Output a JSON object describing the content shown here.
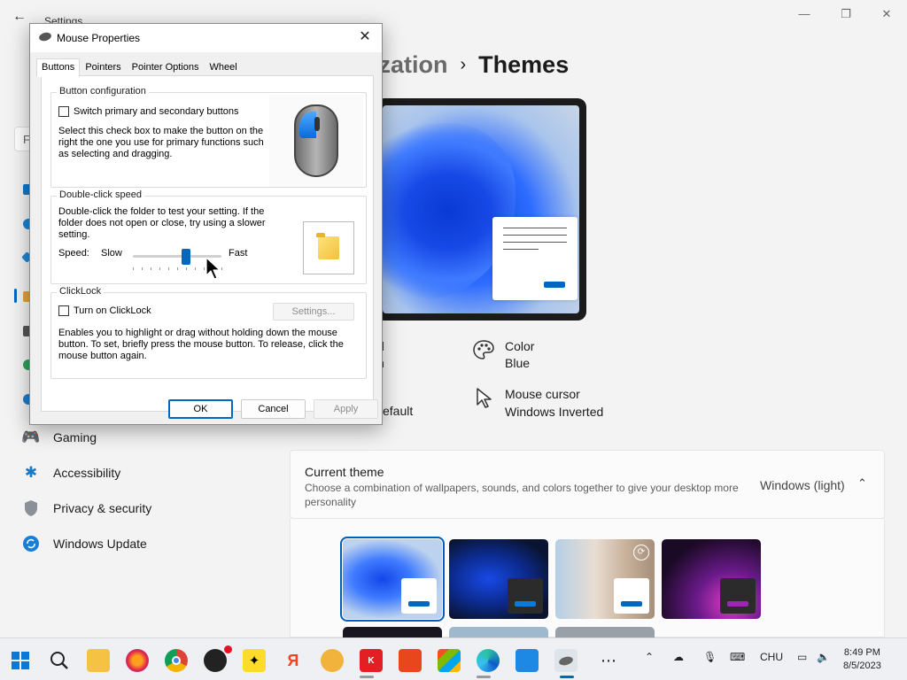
{
  "settings": {
    "window_title": "Settings",
    "breadcrumb_parent": "ization",
    "breadcrumb_sep": "›",
    "breadcrumb_current": "Themes",
    "properties": {
      "background_partial_1": "d",
      "background_partial_2": "n",
      "sound_partial": "efault",
      "color_label": "Color",
      "color_value": "Blue",
      "cursor_label": "Mouse cursor",
      "cursor_value": "Windows Inverted"
    },
    "current_theme": {
      "title": "Current theme",
      "description": "Choose a combination of wallpapers, sounds, and colors together to give your desktop more personality",
      "value": "Windows (light)"
    },
    "nav": {
      "gaming": "Gaming",
      "accessibility": "Accessibility",
      "privacy": "Privacy & security",
      "update": "Windows Update"
    },
    "search_partial": "F"
  },
  "dialog": {
    "title": "Mouse Properties",
    "tabs": [
      "Buttons",
      "Pointers",
      "Pointer Options",
      "Wheel"
    ],
    "button_config": {
      "label": "Button configuration",
      "checkbox": "Switch primary and secondary buttons",
      "checked": false,
      "description": "Select this check box to make the button on the right the one you use for primary functions such as selecting and dragging."
    },
    "double_click": {
      "label": "Double-click speed",
      "description": "Double-click the folder to test your setting. If the folder does not open or close, try using a slower setting.",
      "speed_label": "Speed:",
      "slow": "Slow",
      "fast": "Fast",
      "speed_level": 0.6
    },
    "clicklock": {
      "label": "ClickLock",
      "checkbox": "Turn on ClickLock",
      "checked": false,
      "settings_button": "Settings...",
      "description": "Enables you to highlight or drag without holding down the mouse button. To set, briefly press the mouse button. To release, click the mouse button again."
    },
    "buttons": {
      "ok": "OK",
      "cancel": "Cancel",
      "apply": "Apply"
    }
  },
  "taskbar": {
    "language": "CHU",
    "time": "8:49 PM",
    "date": "8/5/2023"
  },
  "colors": {
    "accent": "#0067c0",
    "taskbar_bg": "#eef0f4"
  }
}
